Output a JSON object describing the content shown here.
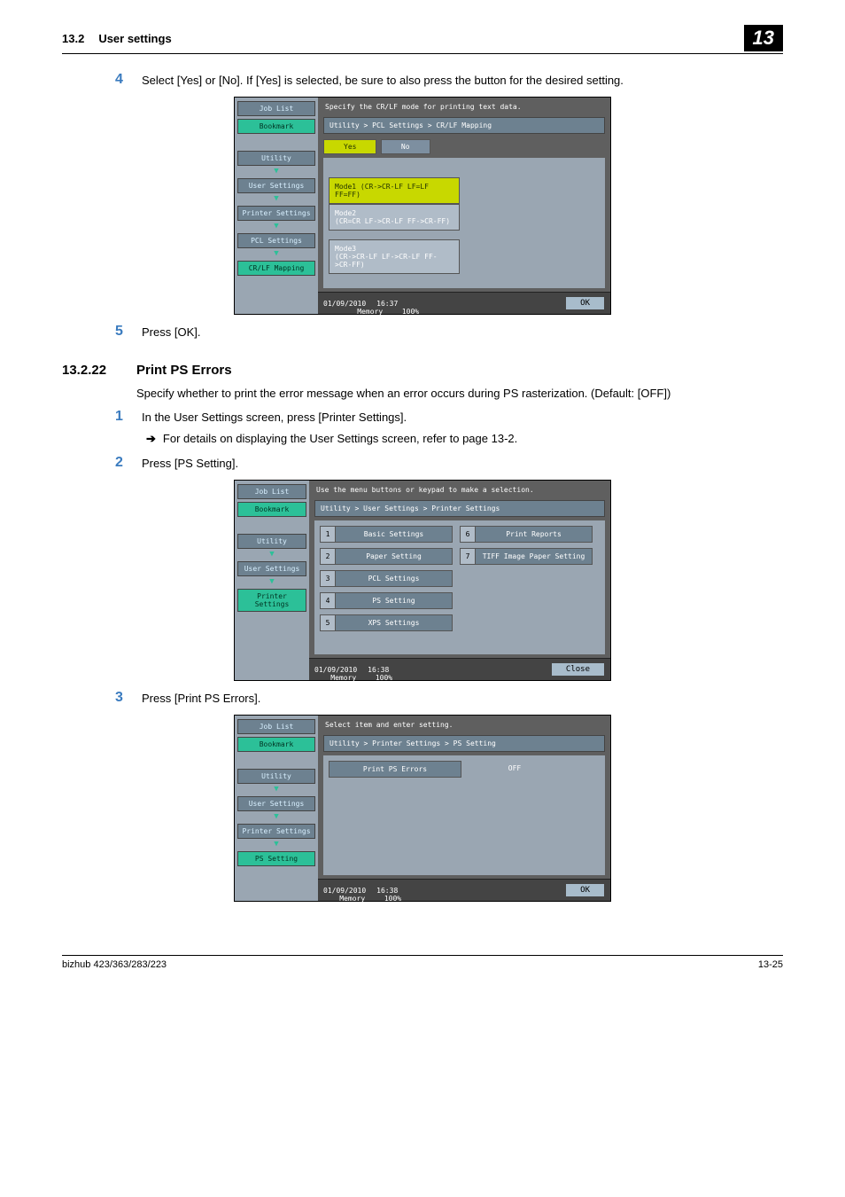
{
  "header": {
    "section_number": "13.2",
    "section_title": "User settings",
    "chapter_num": "13"
  },
  "step4": {
    "num": "4",
    "text": "Select [Yes] or [No]. If [Yes] is selected, be sure to also press the button for the desired setting."
  },
  "ss1": {
    "side": {
      "joblist": "Job List",
      "bookmark": "Bookmark",
      "utility": "Utility",
      "usersettings": "User Settings",
      "printer": "Printer Settings",
      "pcl": "PCL Settings",
      "crlf": "CR/LF Mapping"
    },
    "instr": "Specify the CR/LF mode for printing text data.",
    "crumb": "Utility > PCL Settings > CR/LF Mapping",
    "tabs": {
      "yes": "Yes",
      "no": "No"
    },
    "opts": {
      "mode1": "Mode1 (CR->CR-LF LF=LF FF=FF)",
      "mode2": "Mode2\n(CR=CR LF->CR-LF FF->CR-FF)",
      "mode3": "Mode3\n(CR->CR-LF LF->CR-LF FF->CR-FF)"
    },
    "status": {
      "dt": "01/09/2010",
      "tm": "16:37",
      "mem": "Memory",
      "pct": "100%",
      "ok": "OK"
    }
  },
  "step5": {
    "num": "5",
    "text": "Press [OK]."
  },
  "section_1322": {
    "num": "13.2.22",
    "title": "Print PS Errors"
  },
  "para1": "Specify whether to print the error message when an error occurs during PS rasterization. (Default: [OFF])",
  "step61": {
    "num": "1",
    "text": "In the User Settings screen, press [Printer Settings].",
    "sub": "For details on displaying the User Settings screen, refer to page 13-2."
  },
  "step62": {
    "num": "2",
    "text": "Press [PS Setting]."
  },
  "ss2": {
    "side": {
      "joblist": "Job List",
      "bookmark": "Bookmark",
      "utility": "Utility",
      "usersettings": "User Settings",
      "printer": "Printer Settings"
    },
    "instr": "Use the menu buttons or keypad to make a selection.",
    "crumb": "Utility > User Settings > Printer Settings",
    "menu": {
      "n1": "1",
      "i1": "Basic Settings",
      "n2": "2",
      "i2": "Paper Setting",
      "n3": "3",
      "i3": "PCL Settings",
      "n4": "4",
      "i4": "PS Setting",
      "n5": "5",
      "i5": "XPS Settings",
      "n6": "6",
      "i6": "Print Reports",
      "n7": "7",
      "i7": "TIFF Image Paper Setting"
    },
    "status": {
      "dt": "01/09/2010",
      "tm": "16:38",
      "mem": "Memory",
      "pct": "100%",
      "close": "Close"
    }
  },
  "step63": {
    "num": "3",
    "text": "Press [Print PS Errors]."
  },
  "ss3": {
    "side": {
      "joblist": "Job List",
      "bookmark": "Bookmark",
      "utility": "Utility",
      "usersettings": "User Settings",
      "printer": "Printer Settings",
      "ps": "PS Setting"
    },
    "instr": "Select item and enter setting.",
    "crumb": "Utility > Printer Settings > PS Setting",
    "row": {
      "label": "Print PS Errors",
      "value": "OFF"
    },
    "status": {
      "dt": "01/09/2010",
      "tm": "16:38",
      "mem": "Memory",
      "pct": "100%",
      "ok": "OK"
    }
  },
  "footer": {
    "product": "bizhub 423/363/283/223",
    "page": "13-25"
  }
}
